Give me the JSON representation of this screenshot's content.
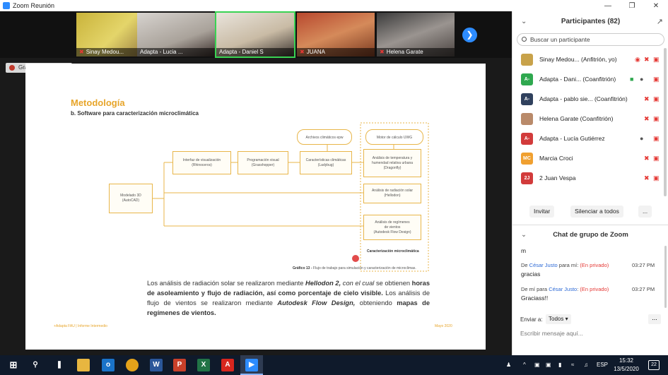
{
  "window": {
    "title": "Zoom Reunión"
  },
  "videos": [
    {
      "name": "Sinay Medou...",
      "muted": true
    },
    {
      "name": "Adapta - Lucia ...",
      "muted": false
    },
    {
      "name": "Adapta - Daniel S",
      "muted": false,
      "active": true
    },
    {
      "name": "JUANA",
      "muted": true
    },
    {
      "name": "Helena Garate",
      "muted": true
    }
  ],
  "recording": {
    "label": "Grabando..."
  },
  "slide": {
    "title": "Metodología",
    "subtitle": "b. Software para caracterización microclimática",
    "boxes": {
      "modelado": "Modelado 3D\n(AutoCAD)",
      "interfaz": "Interfaz de visualización\n(Rhinoceros)",
      "programacion": "Programación visual\n(Grasshopper)",
      "caracteristicas": "Características climáticas\n(Ladybug)",
      "archivos": "Archivos climáticos epw",
      "motor": "Motor de cálculo UWG",
      "temperatura": "Análisis de temperatura y\nhumendad relativa urbana\n(Dragonfly)",
      "radiacion": "Análisis de radiación solar\n(Hellodon)",
      "vientos": "Análisis de regímenes\nde vientos\n(Autodesk Flow Design)"
    },
    "micro_label": "Caracterización microclimática",
    "caption_bold": "Gráfico 13 -",
    "caption_text": "Flujo de trabajo para simulación y caracterización de microclimas.",
    "paragraph": {
      "t1": "Los análisis de radiación solar se realizaron mediante ",
      "t2": "Hellodon 2,",
      "t3": " con el cual",
      "t4": " se obtienen ",
      "t5": "horas de asoleamiento y flujo de radiación, así como porcentaje de cielo visible.",
      "t6": " Los análisis de flujo de vientos se realizaron mediante ",
      "t7": "Autodesk Flow Design,",
      "t8": " obteniendo ",
      "t9": "mapas de regímenes de vientos."
    },
    "footer_left": "+Adapta FAU | Informe Intermedio",
    "footer_right": "Mayo 2020"
  },
  "participants": {
    "header": "Participantes (82)",
    "search_placeholder": "Buscar un participante",
    "list": [
      {
        "initials": "",
        "color": "#c8a24a",
        "name": "Sinay Medou...  (Anfitrión, yo)"
      },
      {
        "initials": "A-",
        "color": "#2fa84f",
        "name": "Adapta - Dani...  (Coanfitrión)"
      },
      {
        "initials": "A-",
        "color": "#30415d",
        "name": "Adapta - pablo sie...  (Coanfitrión)"
      },
      {
        "initials": "",
        "color": "#b98a6a",
        "name": "Helena Garate  (Coanfitrión)"
      },
      {
        "initials": "A-",
        "color": "#d23b3b",
        "name": "Adapta - Lucía Gutiérrez"
      },
      {
        "initials": "MC",
        "color": "#f0a030",
        "name": "Marcia Croci"
      },
      {
        "initials": "2J",
        "color": "#d23b3b",
        "name": "2 Juan Vespa"
      }
    ],
    "invite": "Invitar",
    "mute_all": "Silenciar a todos",
    "more": "..."
  },
  "chat": {
    "header": "Chat de grupo de Zoom",
    "first": "m",
    "messages": [
      {
        "pre": "De ",
        "who": "César Justo",
        "mid": " para mí: ",
        "priv": "(En privado)",
        "time": "03:27 PM",
        "text": "gracias"
      },
      {
        "pre": "De mí para ",
        "who": "César Justo",
        "mid": ": ",
        "priv": "(En privado)",
        "time": "03:27 PM",
        "text": "Graciass!!"
      }
    ],
    "send_to_label": "Enviar a:",
    "send_to_value": "Todos ▾",
    "more": "...",
    "placeholder": "Escribir mensaje aquí..."
  },
  "taskbar": {
    "lang": "ESP",
    "time": "15:32",
    "date": "13/5/2020",
    "notif_count": "22"
  }
}
